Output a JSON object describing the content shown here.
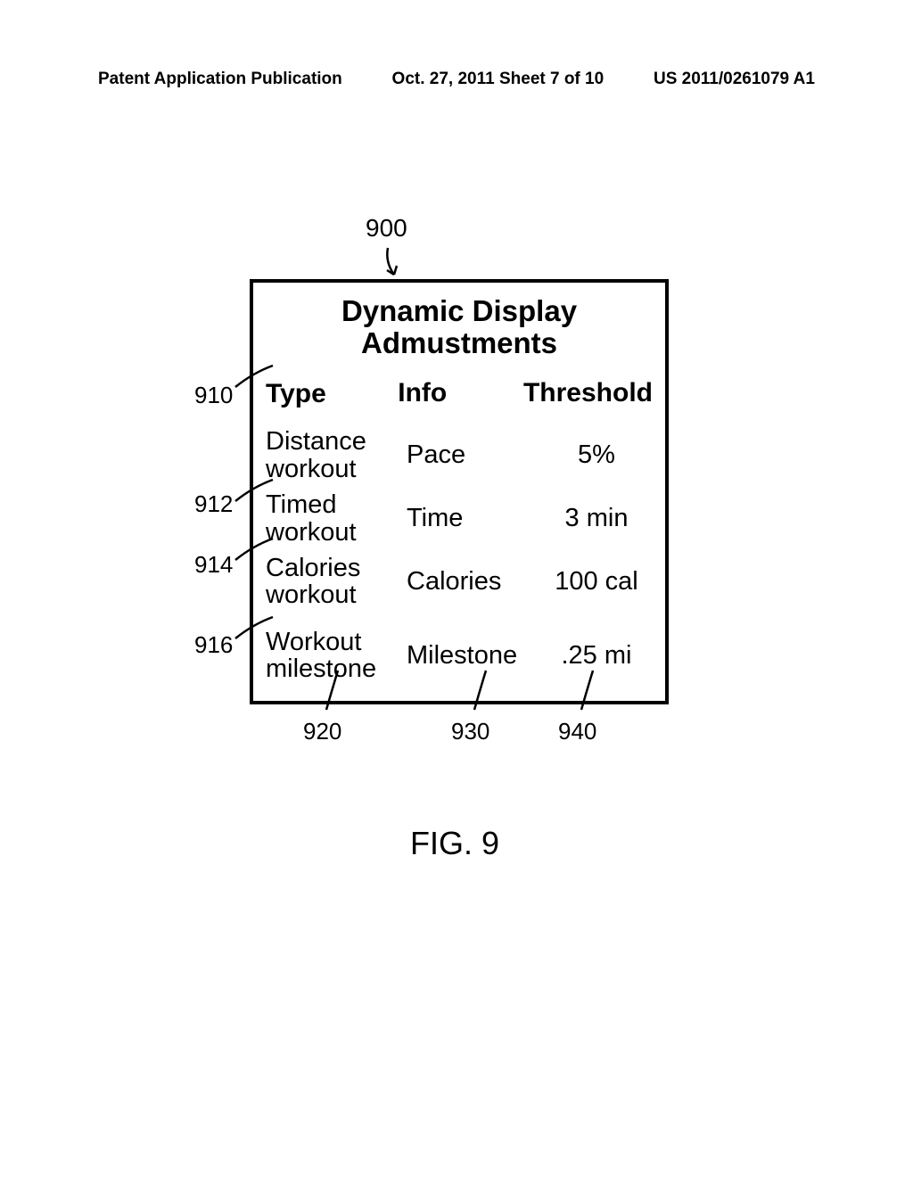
{
  "header": {
    "left": "Patent Application Publication",
    "center": "Oct. 27, 2011  Sheet 7 of 10",
    "right": "US 2011/0261079 A1"
  },
  "figure": {
    "caption": "FIG. 9",
    "title": "Dynamic Display Admustments",
    "columns": {
      "type": "Type",
      "info": "Info",
      "threshold": "Threshold"
    },
    "rows": [
      {
        "type": "Distance workout",
        "info": "Pace",
        "threshold": "5%"
      },
      {
        "type": "Timed workout",
        "info": "Time",
        "threshold": "3 min"
      },
      {
        "type": "Calories workout",
        "info": "Calories",
        "threshold": "100 cal"
      },
      {
        "type": "Workout milestone",
        "info": "Milestone",
        "threshold": ".25 mi"
      }
    ]
  },
  "refs": {
    "top": "900",
    "left": [
      "910",
      "912",
      "914",
      "916"
    ],
    "bottom": [
      "920",
      "930",
      "940"
    ]
  }
}
